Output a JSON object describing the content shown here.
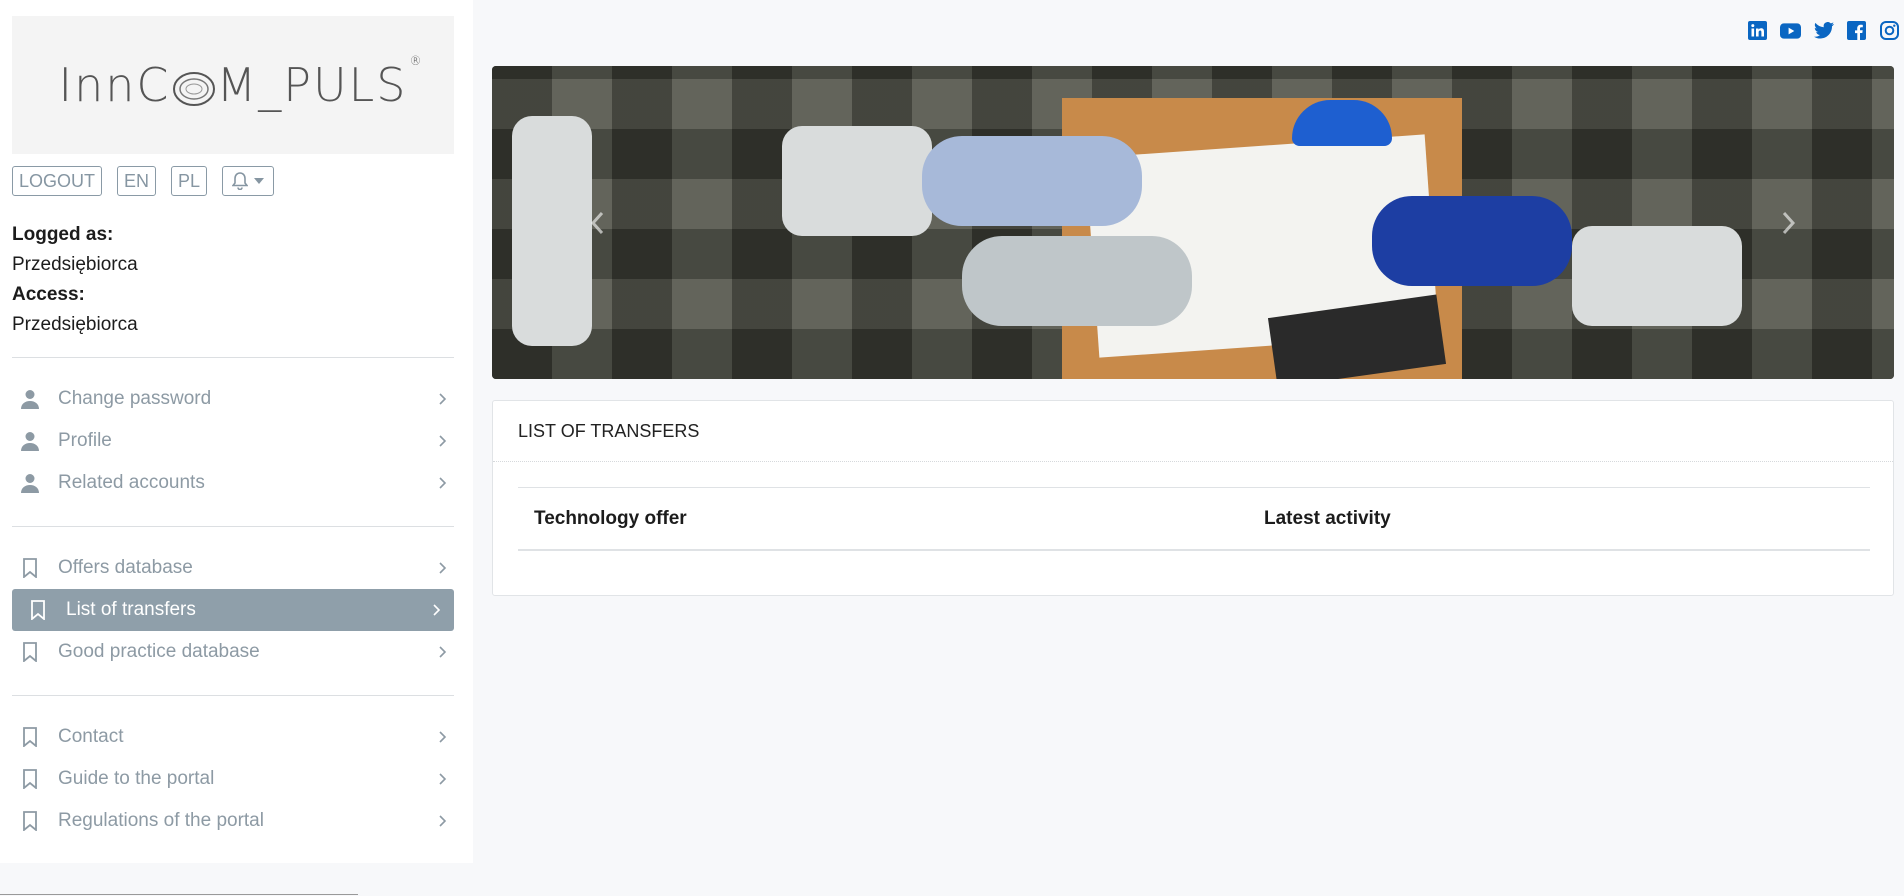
{
  "logo": {
    "text_before": "Inn",
    "text_after": "M_PULS",
    "reg_mark": "®"
  },
  "top_buttons": {
    "logout": "LOGOUT",
    "en": "EN",
    "pl": "PL",
    "bell_icon": "bell-icon"
  },
  "user": {
    "logged_label": "Logged as:",
    "logged_value": "Przedsiębiorca",
    "access_label": "Access:",
    "access_value": "Przedsiębiorca"
  },
  "menu_account": [
    {
      "label": "Change password",
      "icon": "user-icon"
    },
    {
      "label": "Profile",
      "icon": "user-icon"
    },
    {
      "label": "Related accounts",
      "icon": "user-icon"
    }
  ],
  "menu_databases": [
    {
      "label": "Offers database",
      "icon": "bookmark-icon",
      "active": false
    },
    {
      "label": "List of transfers",
      "icon": "bookmark-icon",
      "active": true
    },
    {
      "label": "Good practice database",
      "icon": "bookmark-icon",
      "active": false
    }
  ],
  "menu_info": [
    {
      "label": "Contact",
      "icon": "bookmark-icon"
    },
    {
      "label": "Guide to the portal",
      "icon": "bookmark-icon"
    },
    {
      "label": "Regulations of the portal",
      "icon": "bookmark-icon"
    }
  ],
  "social": [
    "linkedin-icon",
    "youtube-icon",
    "twitter-icon",
    "facebook-icon",
    "instagram-icon"
  ],
  "transfers": {
    "title": "LIST OF TRANSFERS",
    "columns": [
      "Technology offer",
      "Latest activity"
    ]
  },
  "colors": {
    "accent": "#8f9faa",
    "social_blue": "#0a66c2",
    "menu_text": "#8d9aa4"
  }
}
